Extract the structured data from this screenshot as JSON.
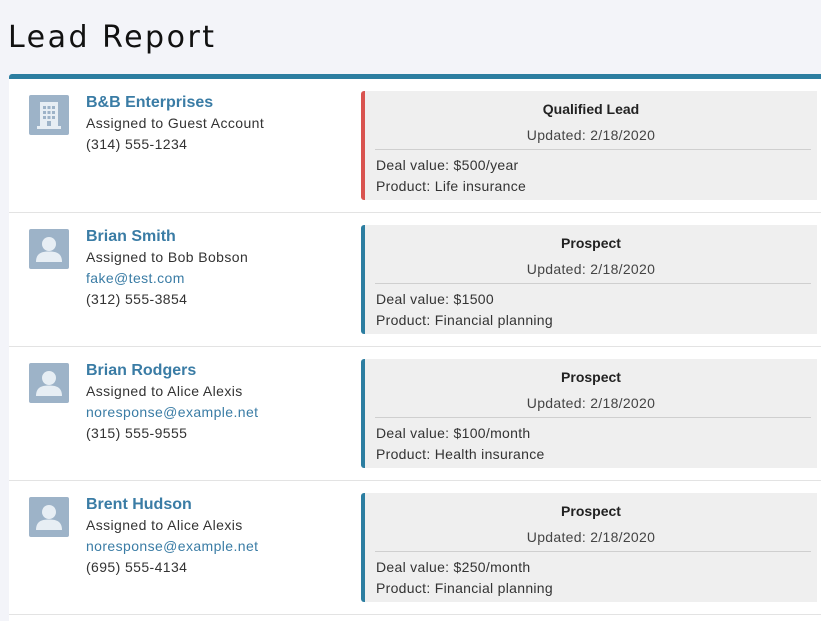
{
  "page": {
    "title": "Lead Report"
  },
  "colors": {
    "accent": "#2c7ea1",
    "qualified": "#d9534f",
    "link": "#3a7ca5",
    "avatar_bg": "#9db3c8"
  },
  "leads": [
    {
      "name": "B&B Enterprises",
      "avatar_icon": "building-icon",
      "assigned": "Assigned to Guest Account",
      "email": "",
      "phone": "(314) 555-1234",
      "status": {
        "title": "Qualified Lead",
        "updated": "Updated: 2/18/2020",
        "deal": "Deal value: $500/year",
        "product": "Product:  Life insurance"
      }
    },
    {
      "name": "Brian Smith",
      "avatar_icon": "person-icon",
      "assigned": "Assigned to Bob Bobson",
      "email": "fake@test.com",
      "phone": "(312) 555-3854",
      "status": {
        "title": "Prospect",
        "updated": "Updated: 2/18/2020",
        "deal": "Deal value: $1500",
        "product": "Product:  Financial planning"
      }
    },
    {
      "name": "Brian Rodgers",
      "avatar_icon": "person-icon",
      "assigned": "Assigned to Alice Alexis",
      "email": "noresponse@example.net",
      "phone": "(315) 555-9555",
      "status": {
        "title": "Prospect",
        "updated": "Updated: 2/18/2020",
        "deal": "Deal value: $100/month",
        "product": "Product:  Health insurance"
      }
    },
    {
      "name": "Brent Hudson",
      "avatar_icon": "person-icon",
      "assigned": "Assigned to Alice Alexis",
      "email": "noresponse@example.net",
      "phone": "(695) 555-4134",
      "status": {
        "title": "Prospect",
        "updated": "Updated: 2/18/2020",
        "deal": "Deal value: $250/month",
        "product": "Product:  Financial planning"
      }
    }
  ]
}
